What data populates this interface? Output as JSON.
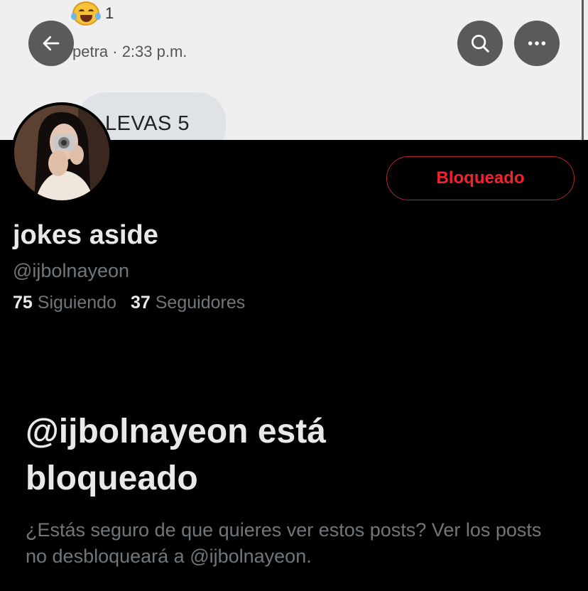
{
  "banner": {
    "reaction_count": "1",
    "meta": "petra · 2:33 p.m.",
    "bubble_text": "LEVAS 5"
  },
  "nav": {
    "back_icon": "arrow-left-icon",
    "search_icon": "search-icon",
    "more_icon": "more-horizontal-icon"
  },
  "profile": {
    "name": "jokes aside",
    "handle": "@ijbolnayeon",
    "following_count": "75",
    "following_label": "Siguiendo",
    "followers_count": "37",
    "followers_label": "Seguidores",
    "blocked_button_label": "Bloqueado"
  },
  "blocked_notice": {
    "title": "@ijbolnayeon está bloqueado",
    "description": "¿Estás seguro de que quieres ver estos posts? Ver los posts no desbloqueará a @ijbolnayeon."
  },
  "colors": {
    "background": "#000000",
    "danger": "#f4212e",
    "muted_text": "#71767b",
    "primary_text": "#e7e9ea"
  }
}
